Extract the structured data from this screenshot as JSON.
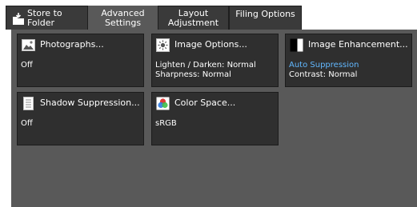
{
  "tabs": [
    {
      "line1": "Store to",
      "line2": "Folder"
    },
    {
      "line1": "Advanced",
      "line2": "Settings"
    },
    {
      "line1": "Layout",
      "line2": "Adjustment"
    },
    {
      "label": "Filing Options"
    }
  ],
  "active_tab": "Advanced Settings",
  "cards": {
    "photographs": {
      "title": "Photographs...",
      "value": "Off"
    },
    "image_options": {
      "title": "Image Options...",
      "line1": "Lighten / Darken: Normal",
      "line2": "Sharpness: Normal"
    },
    "image_enhancement": {
      "title": "Image Enhancement...",
      "line1": "Auto Suppression",
      "line2": "Contrast: Normal"
    },
    "shadow_suppression": {
      "title": "Shadow Suppression...",
      "value": "Off"
    },
    "color_space": {
      "title": "Color Space...",
      "value": "sRGB"
    }
  },
  "colors": {
    "accent": "#62b8ff",
    "panel": "#595959",
    "card": "#2f2f2f"
  },
  "icons": [
    "store-to-folder-icon",
    "photo-icon",
    "image-options-icon",
    "contrast-icon",
    "document-icon",
    "color-space-icon"
  ]
}
